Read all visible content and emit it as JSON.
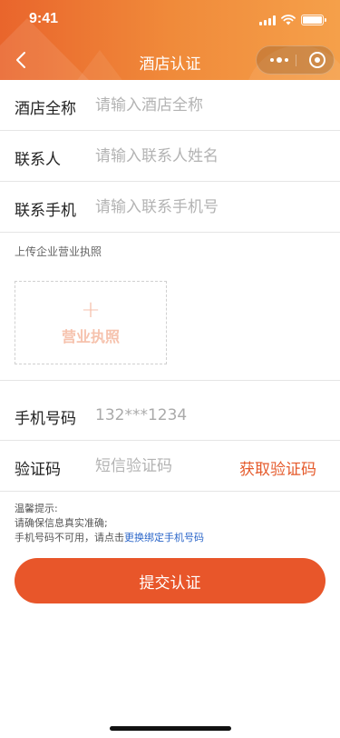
{
  "status_bar": {
    "time": "9:41"
  },
  "nav": {
    "title": "酒店认证"
  },
  "form": {
    "hotel_name": {
      "label": "酒店全称",
      "placeholder": "请输入酒店全称"
    },
    "contact": {
      "label": "联系人",
      "placeholder": "请输入联系人姓名"
    },
    "contact_phone": {
      "label": "联系手机",
      "placeholder": "请输入联系手机号"
    },
    "upload": {
      "title": "上传企业营业执照",
      "plus": "+",
      "label": "营业执照"
    },
    "phone": {
      "label": "手机号码",
      "value": "132***1234"
    },
    "code": {
      "label": "验证码",
      "placeholder": "短信验证码",
      "get_code": "获取验证码"
    }
  },
  "tips": {
    "line1": "温馨提示:",
    "line2": "请确保信息真实准确;",
    "line3_prefix": "手机号码不可用，请点击",
    "line3_link": "更换绑定手机号码"
  },
  "submit_label": "提交认证",
  "colors": {
    "accent": "#e8562a",
    "header_start": "#e9652c",
    "header_end": "#f5a04a",
    "link": "#2b66c9"
  }
}
